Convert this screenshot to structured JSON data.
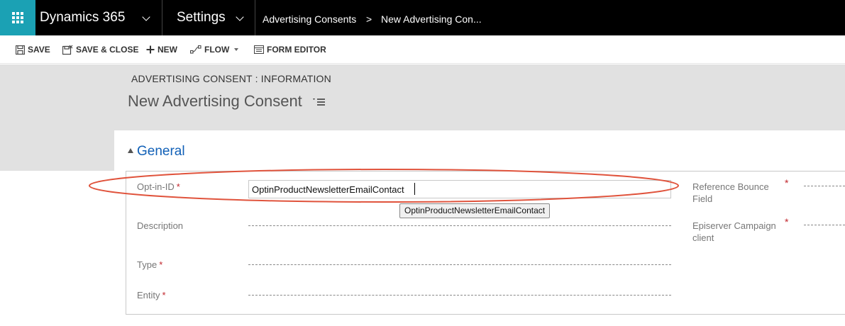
{
  "topbar": {
    "app_name": "Dynamics 365",
    "app_chevron": "chevron-down-icon",
    "area_name": "Settings",
    "area_chevron": "chevron-down-icon",
    "breadcrumb": [
      "Advertising Consents",
      "New Advertising Con..."
    ],
    "breadcrumb_separator": ">",
    "waffle_icon": "app-launcher-icon",
    "accent_color": "#1ba1b4"
  },
  "commandbar": {
    "save": "SAVE",
    "save_close": "SAVE & CLOSE",
    "new": "NEW",
    "flow": "FLOW",
    "form_editor": "FORM EDITOR"
  },
  "header": {
    "entity_label": "ADVERTISING CONSENT : INFORMATION",
    "record_title": "New Advertising Consent"
  },
  "section": {
    "title": "General"
  },
  "fields": {
    "optin_id": {
      "label": "Opt-in-ID",
      "required_marker": "*",
      "value": "OptinProductNewsletterEmailContact"
    },
    "description": {
      "label": "Description"
    },
    "type": {
      "label": "Type",
      "required_marker": "*"
    },
    "entity": {
      "label": "Entity",
      "required_marker": "*"
    },
    "reference_bounce": {
      "label_line1": "Reference Bounce",
      "label_line2": "Field",
      "required_marker": "*"
    },
    "episerver_client": {
      "label_line1": "Episerver Campaign",
      "label_line2": "client",
      "required_marker": "*"
    }
  },
  "tooltip": {
    "text": "OptinProductNewsletterEmailContact"
  },
  "colors": {
    "highlight_ellipse": "#e0533c",
    "section_title": "#1160b7",
    "required": "#c1272d"
  }
}
